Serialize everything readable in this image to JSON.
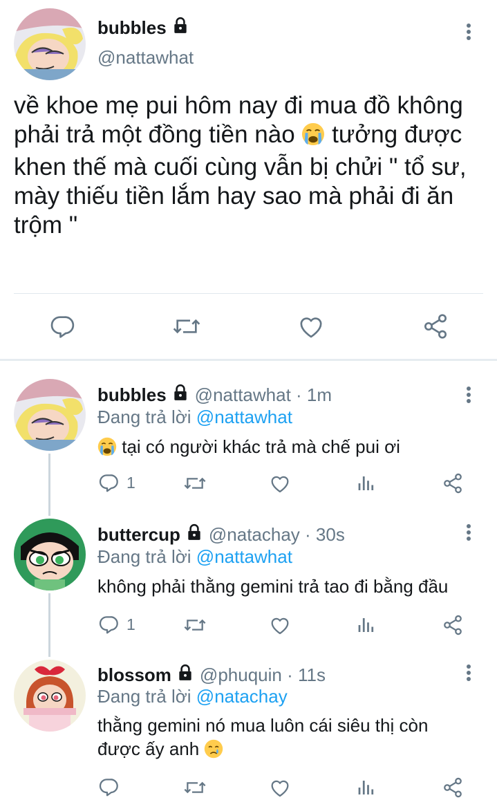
{
  "main_tweet": {
    "display_name": "bubbles",
    "handle": "@nattawhat",
    "text_parts": [
      "về khoe mẹ pui hôm nay đi mua đồ không phải trả một đồng tiền nào ",
      " tưởng được khen thế mà cuối cùng vẫn bị chửi \" tổ sư, mày thiếu tiền lắm hay sao mà phải đi ăn trộm \""
    ],
    "icons": {
      "lock": "lock-icon",
      "more": "more-vertical-icon",
      "emoji": "loudly-crying-face-emoji",
      "reply": "comment-icon",
      "retweet": "retweet-icon",
      "like": "heart-icon",
      "share": "share-icon"
    }
  },
  "replies": [
    {
      "display_name": "bubbles",
      "handle_time": "@nattawhat · 1m",
      "replying_prefix": "Đang trả lời",
      "replying_to": "@nattawhat",
      "text_before_emoji": "",
      "text": " tại có người khác trả mà chế pui ơi",
      "emoji": "loudly-crying-face-emoji",
      "reply_count": "1"
    },
    {
      "display_name": "buttercup",
      "handle_time": "@natachay · 30s",
      "replying_prefix": "Đang trả lời",
      "replying_to": "@nattawhat",
      "text": "không phải thằng gemini trả tao đi bằng đầu",
      "reply_count": "1"
    },
    {
      "display_name": "blossom",
      "handle_time": "@phuquin · 11s",
      "replying_prefix": "Đang trả lời",
      "replying_to": "@natachay",
      "text": "thằng gemini nó mua luôn cái siêu thị còn được ấy anh ",
      "emoji": "crying-face-emoji",
      "reply_count": ""
    }
  ],
  "colors": {
    "text": "#14171a",
    "secondary": "#657786",
    "link": "#1da1f2",
    "divider": "#e1e8ed"
  }
}
